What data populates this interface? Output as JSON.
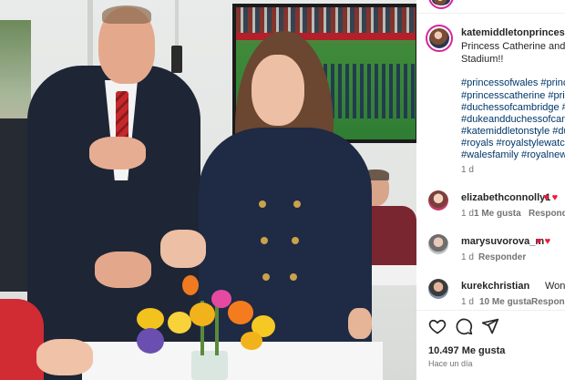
{
  "post": {
    "author": "katemiddletonprincessofwales",
    "caption": "Princess Catherine and Prince William at the Principality Stadium!!",
    "hashtags": [
      "#princessofwales #princeofwales",
      "#princesscatherine #princewilliam",
      "#duchessofcambridge #princecharles",
      "#dukeandduchessofcambridge",
      "#katemiddletonstyle #duchessofwales",
      "#royals #royalstylewatch #royalfamily",
      "#walesfamily #royalnews"
    ],
    "caption_age": "1 d"
  },
  "comments": [
    {
      "user": "elizabethconnolly1",
      "text": "",
      "hearts": "♥ ♥",
      "age": "1 d",
      "likes": "1 Me gusta",
      "reply": "Responder"
    },
    {
      "user": "marysuvorova_m",
      "text": "",
      "hearts": "♥ ♥",
      "age": "1 d",
      "likes": "",
      "reply": "Responder"
    },
    {
      "user": "kurekchristian",
      "text": "Wonderful",
      "hearts": "",
      "age": "1 d",
      "likes": "10 Me gusta",
      "reply": "Responder"
    }
  ],
  "actions": {
    "like_icon": "heart-outline-icon",
    "comment_icon": "speech-bubble-icon",
    "share_icon": "paper-plane-icon"
  },
  "stats": {
    "likes": "10.497 Me gusta",
    "posted": "Hace un día"
  },
  "colors": {
    "hashtag": "#00376b",
    "heart": "#ed1a3b",
    "meta": "#737373",
    "story_ring": "#d6249f"
  }
}
